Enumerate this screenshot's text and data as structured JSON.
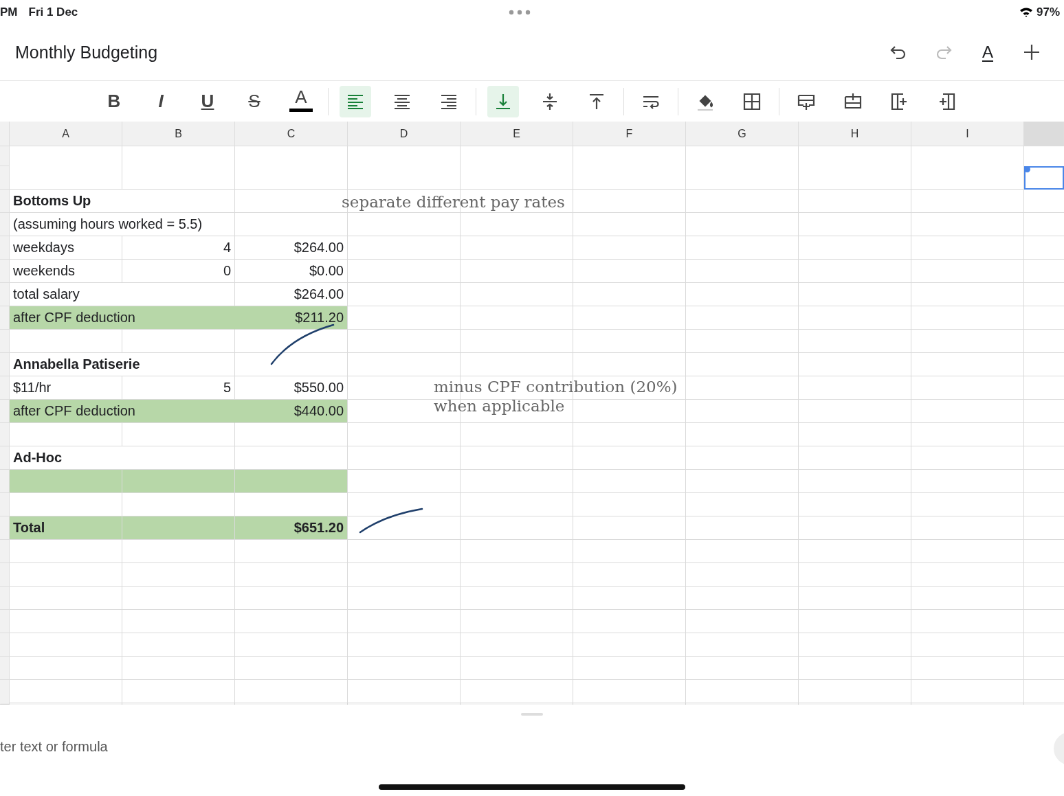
{
  "status_bar": {
    "time": "PM",
    "date": "Fri 1 Dec",
    "battery": "97%"
  },
  "title": "Monthly Budgeting",
  "header_actions": [
    {
      "kind": "undo",
      "disabled": false
    },
    {
      "kind": "redo",
      "disabled": true
    },
    {
      "kind": "text-format",
      "glyph": "A",
      "disabled": false
    },
    {
      "kind": "add",
      "disabled": false
    }
  ],
  "format_toolbar": [
    [
      {
        "kind": "bold",
        "glyph": "B",
        "selected": false
      },
      {
        "kind": "italic",
        "glyph": "I",
        "selected": false
      },
      {
        "kind": "underline",
        "glyph": "U",
        "selected": false
      },
      {
        "kind": "strike",
        "glyph": "S",
        "selected": false
      },
      {
        "kind": "text-color",
        "glyph": "A",
        "selected": false
      }
    ],
    [
      {
        "kind": "align-left",
        "selected": true
      },
      {
        "kind": "align-center",
        "selected": false
      },
      {
        "kind": "align-right",
        "selected": false
      }
    ],
    [
      {
        "kind": "valign-bottom",
        "selected": true
      },
      {
        "kind": "valign-middle",
        "selected": false
      },
      {
        "kind": "valign-top",
        "selected": false
      }
    ],
    [
      {
        "kind": "wrap",
        "selected": false
      }
    ],
    [
      {
        "kind": "fill",
        "selected": false
      },
      {
        "kind": "borders",
        "selected": false
      }
    ],
    [
      {
        "kind": "insert-row-above",
        "selected": false
      },
      {
        "kind": "insert-row-below",
        "selected": false
      },
      {
        "kind": "insert-col-left",
        "selected": false
      },
      {
        "kind": "insert-col-right",
        "selected": false
      }
    ]
  ],
  "columns": [
    "A",
    "B",
    "C",
    "D",
    "E",
    "F",
    "G",
    "H",
    "I"
  ],
  "rows": [
    {
      "cells": {},
      "highlighted": false,
      "selected": false
    },
    {
      "cells": {},
      "highlighted": false,
      "selected": true
    },
    {
      "cells": {
        "A": "Bottoms Up"
      },
      "bold": true,
      "highlighted": false,
      "selected": false
    },
    {
      "cells": {
        "A": "(assuming hours worked = 5.5)"
      },
      "bold": false,
      "highlighted": false,
      "selected": false
    },
    {
      "cells": {
        "A": "weekdays",
        "B": "4",
        "C": "$264.00"
      },
      "bold": false,
      "highlighted": false,
      "selected": false
    },
    {
      "cells": {
        "A": "weekends",
        "B": "0",
        "C": "$0.00"
      },
      "bold": false,
      "highlighted": false,
      "selected": false
    },
    {
      "cells": {
        "A": "total salary",
        "C": "$264.00"
      },
      "bold": false,
      "highlighted": false,
      "selected": false
    },
    {
      "cells": {
        "A": "after CPF deduction",
        "C": "$211.20"
      },
      "bold": false,
      "highlighted": true,
      "merged": true,
      "selected": false
    },
    {
      "cells": {},
      "highlighted": false,
      "selected": false
    },
    {
      "cells": {
        "A": "Annabella Patiserie"
      },
      "bold": true,
      "highlighted": false,
      "selected": false
    },
    {
      "cells": {
        "A": "$11/hr",
        "B": "5",
        "C": "$550.00"
      },
      "bold": false,
      "highlighted": false,
      "selected": false
    },
    {
      "cells": {
        "A": "after CPF deduction",
        "C": "$440.00"
      },
      "bold": false,
      "highlighted": true,
      "merged": true,
      "selected": false
    },
    {
      "cells": {},
      "highlighted": false,
      "selected": false
    },
    {
      "cells": {
        "A": "Ad-Hoc"
      },
      "bold": true,
      "highlighted": false,
      "selected": false
    },
    {
      "cells": {},
      "highlighted": true,
      "merged": false,
      "selected": false
    },
    {
      "cells": {},
      "highlighted": false,
      "selected": false
    },
    {
      "cells": {
        "A": "Total",
        "C": "$651.20"
      },
      "bold": true,
      "highlighted": true,
      "merged": false,
      "selected": false
    }
  ],
  "annotations": [
    {
      "lines": [
        "separate different pay rates"
      ]
    },
    {
      "lines": [
        "minus CPF contribution (20%)",
        "when applicable"
      ]
    }
  ],
  "formula_bar": {
    "placeholder": "ter text or formula"
  }
}
